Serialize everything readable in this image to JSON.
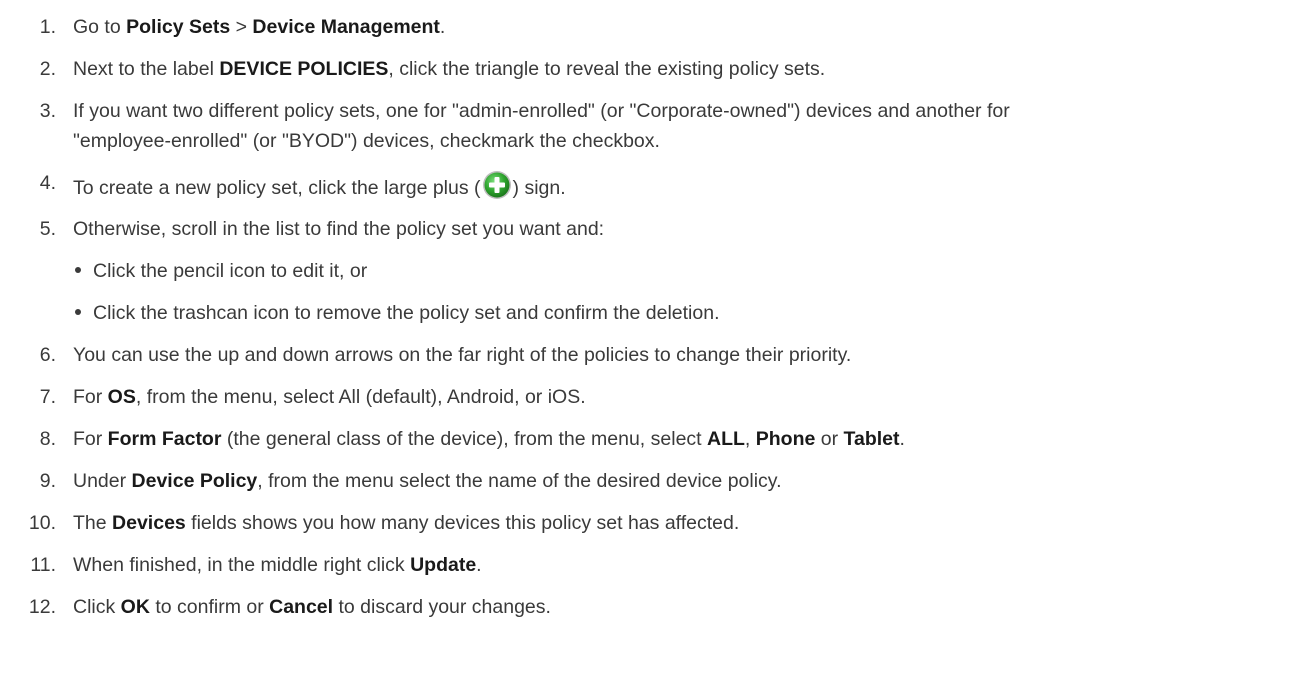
{
  "steps": [
    {
      "num": "1.",
      "parts": [
        {
          "t": "Go to "
        },
        {
          "b": "Policy Sets"
        },
        {
          "t": " > "
        },
        {
          "b": "Device Management"
        },
        {
          "t": "."
        }
      ]
    },
    {
      "num": "2.",
      "parts": [
        {
          "t": "Next to the label "
        },
        {
          "b": "DEVICE POLICIES"
        },
        {
          "t": ", click the triangle to reveal the existing policy sets."
        }
      ]
    },
    {
      "num": "3.",
      "line1": "If you want two different policy sets, one for \"admin-enrolled\" (or \"Corporate-owned\") devices and another for",
      "line2": "\"employee-enrolled\" (or \"BYOD\") devices, checkmark the checkbox."
    },
    {
      "num": "4.",
      "before_icon": "To create a new policy set, click the large plus (",
      "after_icon": ") sign."
    },
    {
      "num": "5.",
      "text": "Otherwise, scroll in the list to find the policy set you want and:"
    },
    {
      "num": "6.",
      "text": "You can use the up and down arrows on the far right of the policies to change their priority."
    },
    {
      "num": "7.",
      "parts": [
        {
          "t": "For "
        },
        {
          "b": "OS"
        },
        {
          "t": ", from the menu, select All (default), Android, or iOS."
        }
      ]
    },
    {
      "num": "8.",
      "parts": [
        {
          "t": "For "
        },
        {
          "b": "Form Factor"
        },
        {
          "t": " (the general class of the device), from the menu, select "
        },
        {
          "b": "ALL"
        },
        {
          "t": ", "
        },
        {
          "b": "Phone"
        },
        {
          "t": " or "
        },
        {
          "b": "Tablet"
        },
        {
          "t": "."
        }
      ]
    },
    {
      "num": "9.",
      "parts": [
        {
          "t": "Under "
        },
        {
          "b": "Device Policy"
        },
        {
          "t": ", from the menu select the name of the desired device policy."
        }
      ]
    },
    {
      "num": "10.",
      "parts": [
        {
          "t": "The "
        },
        {
          "b": "Devices"
        },
        {
          "t": " fields shows you how many devices this policy set has affected."
        }
      ]
    },
    {
      "num": "11.",
      "parts": [
        {
          "t": "When finished, in the middle right click "
        },
        {
          "b": "Update"
        },
        {
          "t": "."
        }
      ]
    },
    {
      "num": "12.",
      "parts": [
        {
          "t": "Click "
        },
        {
          "b": "OK"
        },
        {
          "t": " to confirm or "
        },
        {
          "b": "Cancel"
        },
        {
          "t": " to discard your changes."
        }
      ]
    }
  ],
  "sub_items": [
    "Click the pencil icon to edit it, or",
    "Click the trashcan icon to remove the policy set and confirm the deletion."
  ],
  "icons": {
    "plus": "plus-circle-icon",
    "plus_color": "#2e9e2e"
  }
}
